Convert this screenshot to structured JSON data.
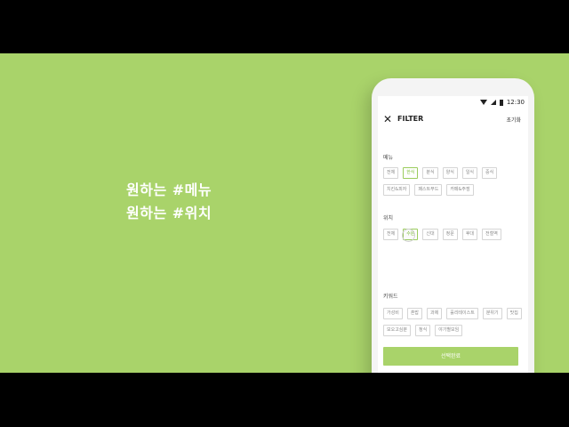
{
  "headline": {
    "line1": "원하는 #메뉴",
    "line2": "원하는 #위치"
  },
  "status_bar": {
    "time": "12:30"
  },
  "filter": {
    "title": "FILTER",
    "reset_label": "초기화",
    "sections": [
      {
        "title": "메뉴",
        "chips": [
          {
            "label": "전체",
            "active": false
          },
          {
            "label": "한식",
            "active": true
          },
          {
            "label": "분식",
            "active": false
          },
          {
            "label": "양식",
            "active": false
          },
          {
            "label": "일식",
            "active": false
          },
          {
            "label": "중식",
            "active": false
          },
          {
            "label": "치킨&피자",
            "active": false
          },
          {
            "label": "패스트푸드",
            "active": false
          },
          {
            "label": "카페&주점",
            "active": false
          }
        ]
      },
      {
        "title": "위치",
        "chips": [
          {
            "label": "전체",
            "active": false
          },
          {
            "label": "수원",
            "active": true
          },
          {
            "label": "신대",
            "active": false
          },
          {
            "label": "정문",
            "active": false
          },
          {
            "label": "후대",
            "active": false
          },
          {
            "label": "전철역",
            "active": false
          }
        ]
      },
      {
        "title": "키워드",
        "chips": [
          {
            "label": "가성비",
            "active": false
          },
          {
            "label": "혼밥",
            "active": false
          },
          {
            "label": "과제",
            "active": false
          },
          {
            "label": "훌리테이스트",
            "active": false
          },
          {
            "label": "분위기",
            "active": false
          },
          {
            "label": "맛집",
            "active": false
          },
          {
            "label": "모오고심분",
            "active": false
          },
          {
            "label": "청식",
            "active": false
          },
          {
            "label": "야기별모임",
            "active": false
          }
        ]
      }
    ],
    "confirm_label": "선택완료"
  },
  "colors": {
    "background": "#a9d36a",
    "accent": "#7fbf3a"
  }
}
